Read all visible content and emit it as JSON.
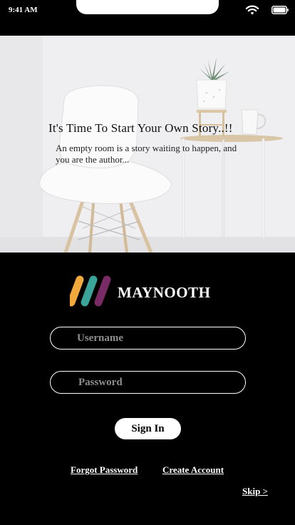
{
  "status_bar": {
    "time": "9:41 AM"
  },
  "hero": {
    "title": "It's Time To Start Your Own Story..!!",
    "subtitle": "An empty room is a story waiting to happen, and you are the author..."
  },
  "brand": {
    "name": "MAYNOOTH",
    "colors": [
      "#f2a93b",
      "#3aa39a",
      "#7a2a64"
    ]
  },
  "form": {
    "username_placeholder": "Username",
    "password_placeholder": "Password",
    "signin_label": "Sign In"
  },
  "links": {
    "forgot_password": "Forgot Password",
    "create_account": "Create Account",
    "skip": "Skip >"
  },
  "icons": {
    "wifi": "wifi-icon",
    "battery": "battery-icon"
  }
}
